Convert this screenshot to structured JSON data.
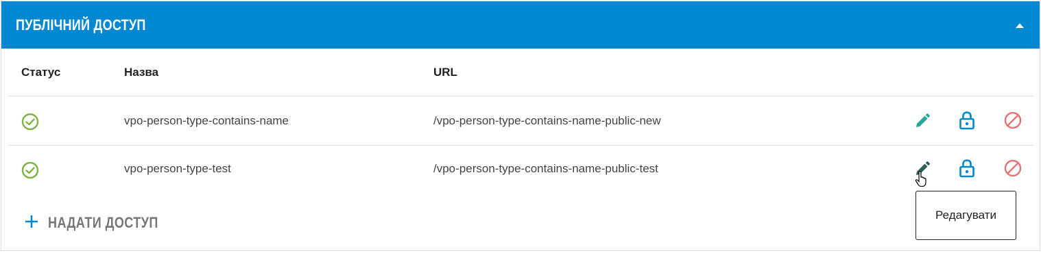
{
  "panel": {
    "title": "ПУБЛІЧНИЙ ДОСТУП",
    "collapse_icon": "caret-up-icon",
    "header_color": "#0288d1"
  },
  "table": {
    "columns": {
      "status": "Статус",
      "name": "Назва",
      "url": "URL"
    },
    "rows": [
      {
        "status_icon": "check-circle-icon",
        "name": "vpo-person-type-contains-name",
        "url": "/vpo-person-type-contains-name-public-new",
        "actions": [
          "edit-icon",
          "lock-icon",
          "block-icon"
        ]
      },
      {
        "status_icon": "check-circle-icon",
        "name": "vpo-person-type-test",
        "url": "/vpo-person-type-contains-name-public-test",
        "actions": [
          "edit-icon",
          "lock-icon",
          "block-icon"
        ]
      }
    ]
  },
  "add_access": {
    "label": "НАДАТИ ДОСТУП",
    "icon": "plus-icon"
  },
  "tooltip": {
    "text": "Редагувати"
  },
  "colors": {
    "status_ok": "#7cb342",
    "edit": "#26a69a",
    "lock": "#0288d1",
    "block": "#e57373",
    "accent": "#0288d1"
  }
}
